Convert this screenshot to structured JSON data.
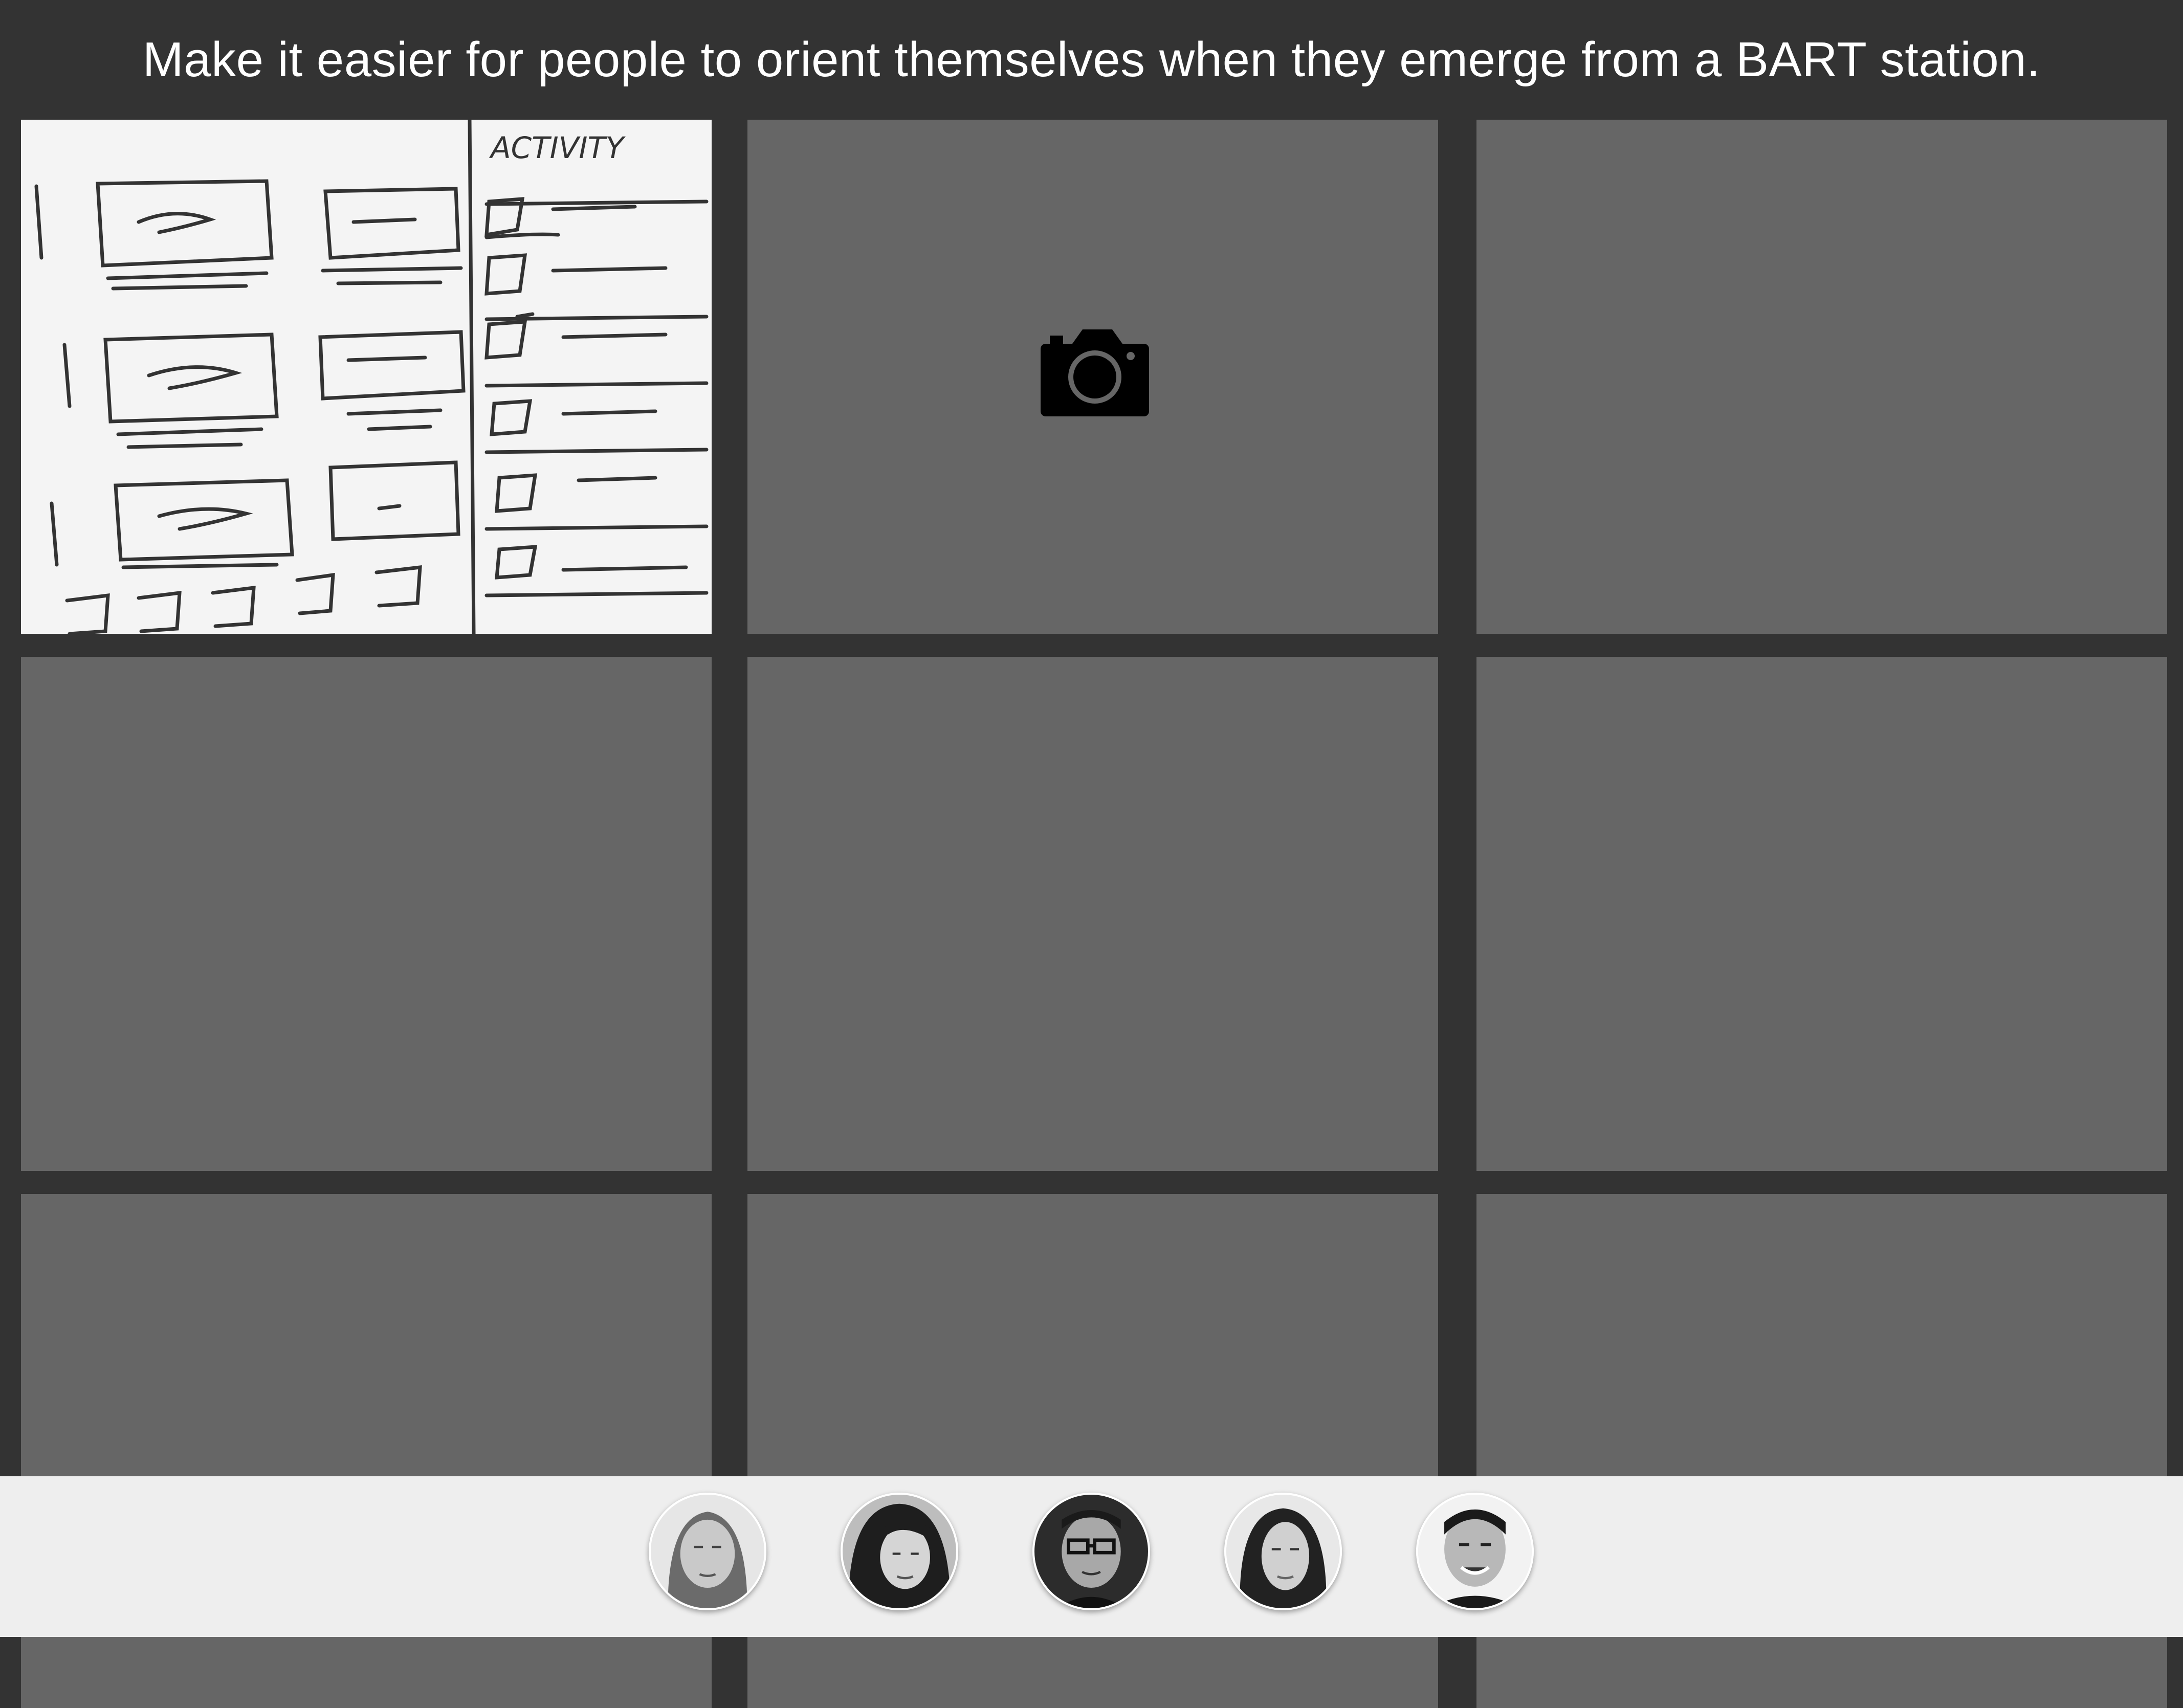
{
  "header": {
    "prompt": "Make it easier for people to orient themselves when they emerge from a BART station."
  },
  "grid": {
    "tiles": [
      {
        "state": "photo",
        "content": "sketch-image",
        "sketch_label": "ACTIVITY"
      },
      {
        "state": "add-photo",
        "icon": "camera-icon"
      },
      {
        "state": "empty"
      },
      {
        "state": "empty"
      },
      {
        "state": "empty"
      },
      {
        "state": "empty"
      },
      {
        "state": "empty"
      },
      {
        "state": "empty"
      },
      {
        "state": "empty"
      }
    ]
  },
  "participants": [
    {
      "avatar": "avatar-1"
    },
    {
      "avatar": "avatar-2"
    },
    {
      "avatar": "avatar-3"
    },
    {
      "avatar": "avatar-4"
    },
    {
      "avatar": "avatar-5"
    }
  ],
  "colors": {
    "background": "#333333",
    "tile": "#666666",
    "tray": "#eeeeee",
    "text": "#ffffff"
  }
}
